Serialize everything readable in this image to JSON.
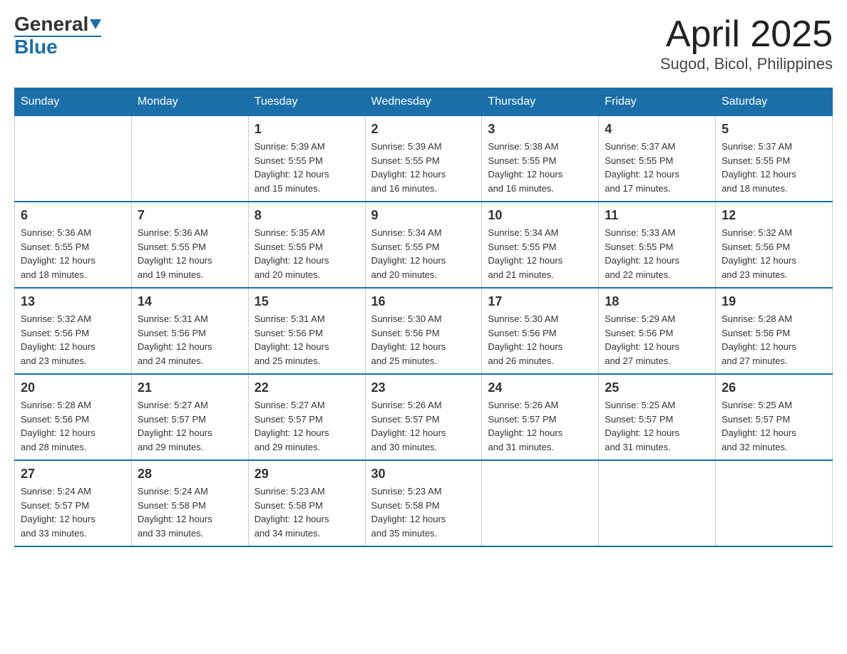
{
  "logo": {
    "general": "General",
    "blue": "Blue"
  },
  "title": "April 2025",
  "subtitle": "Sugod, Bicol, Philippines",
  "headers": [
    "Sunday",
    "Monday",
    "Tuesday",
    "Wednesday",
    "Thursday",
    "Friday",
    "Saturday"
  ],
  "weeks": [
    [
      {
        "day": "",
        "info": ""
      },
      {
        "day": "",
        "info": ""
      },
      {
        "day": "1",
        "info": "Sunrise: 5:39 AM\nSunset: 5:55 PM\nDaylight: 12 hours\nand 15 minutes."
      },
      {
        "day": "2",
        "info": "Sunrise: 5:39 AM\nSunset: 5:55 PM\nDaylight: 12 hours\nand 16 minutes."
      },
      {
        "day": "3",
        "info": "Sunrise: 5:38 AM\nSunset: 5:55 PM\nDaylight: 12 hours\nand 16 minutes."
      },
      {
        "day": "4",
        "info": "Sunrise: 5:37 AM\nSunset: 5:55 PM\nDaylight: 12 hours\nand 17 minutes."
      },
      {
        "day": "5",
        "info": "Sunrise: 5:37 AM\nSunset: 5:55 PM\nDaylight: 12 hours\nand 18 minutes."
      }
    ],
    [
      {
        "day": "6",
        "info": "Sunrise: 5:36 AM\nSunset: 5:55 PM\nDaylight: 12 hours\nand 18 minutes."
      },
      {
        "day": "7",
        "info": "Sunrise: 5:36 AM\nSunset: 5:55 PM\nDaylight: 12 hours\nand 19 minutes."
      },
      {
        "day": "8",
        "info": "Sunrise: 5:35 AM\nSunset: 5:55 PM\nDaylight: 12 hours\nand 20 minutes."
      },
      {
        "day": "9",
        "info": "Sunrise: 5:34 AM\nSunset: 5:55 PM\nDaylight: 12 hours\nand 20 minutes."
      },
      {
        "day": "10",
        "info": "Sunrise: 5:34 AM\nSunset: 5:55 PM\nDaylight: 12 hours\nand 21 minutes."
      },
      {
        "day": "11",
        "info": "Sunrise: 5:33 AM\nSunset: 5:55 PM\nDaylight: 12 hours\nand 22 minutes."
      },
      {
        "day": "12",
        "info": "Sunrise: 5:32 AM\nSunset: 5:56 PM\nDaylight: 12 hours\nand 23 minutes."
      }
    ],
    [
      {
        "day": "13",
        "info": "Sunrise: 5:32 AM\nSunset: 5:56 PM\nDaylight: 12 hours\nand 23 minutes."
      },
      {
        "day": "14",
        "info": "Sunrise: 5:31 AM\nSunset: 5:56 PM\nDaylight: 12 hours\nand 24 minutes."
      },
      {
        "day": "15",
        "info": "Sunrise: 5:31 AM\nSunset: 5:56 PM\nDaylight: 12 hours\nand 25 minutes."
      },
      {
        "day": "16",
        "info": "Sunrise: 5:30 AM\nSunset: 5:56 PM\nDaylight: 12 hours\nand 25 minutes."
      },
      {
        "day": "17",
        "info": "Sunrise: 5:30 AM\nSunset: 5:56 PM\nDaylight: 12 hours\nand 26 minutes."
      },
      {
        "day": "18",
        "info": "Sunrise: 5:29 AM\nSunset: 5:56 PM\nDaylight: 12 hours\nand 27 minutes."
      },
      {
        "day": "19",
        "info": "Sunrise: 5:28 AM\nSunset: 5:56 PM\nDaylight: 12 hours\nand 27 minutes."
      }
    ],
    [
      {
        "day": "20",
        "info": "Sunrise: 5:28 AM\nSunset: 5:56 PM\nDaylight: 12 hours\nand 28 minutes."
      },
      {
        "day": "21",
        "info": "Sunrise: 5:27 AM\nSunset: 5:57 PM\nDaylight: 12 hours\nand 29 minutes."
      },
      {
        "day": "22",
        "info": "Sunrise: 5:27 AM\nSunset: 5:57 PM\nDaylight: 12 hours\nand 29 minutes."
      },
      {
        "day": "23",
        "info": "Sunrise: 5:26 AM\nSunset: 5:57 PM\nDaylight: 12 hours\nand 30 minutes."
      },
      {
        "day": "24",
        "info": "Sunrise: 5:26 AM\nSunset: 5:57 PM\nDaylight: 12 hours\nand 31 minutes."
      },
      {
        "day": "25",
        "info": "Sunrise: 5:25 AM\nSunset: 5:57 PM\nDaylight: 12 hours\nand 31 minutes."
      },
      {
        "day": "26",
        "info": "Sunrise: 5:25 AM\nSunset: 5:57 PM\nDaylight: 12 hours\nand 32 minutes."
      }
    ],
    [
      {
        "day": "27",
        "info": "Sunrise: 5:24 AM\nSunset: 5:57 PM\nDaylight: 12 hours\nand 33 minutes."
      },
      {
        "day": "28",
        "info": "Sunrise: 5:24 AM\nSunset: 5:58 PM\nDaylight: 12 hours\nand 33 minutes."
      },
      {
        "day": "29",
        "info": "Sunrise: 5:23 AM\nSunset: 5:58 PM\nDaylight: 12 hours\nand 34 minutes."
      },
      {
        "day": "30",
        "info": "Sunrise: 5:23 AM\nSunset: 5:58 PM\nDaylight: 12 hours\nand 35 minutes."
      },
      {
        "day": "",
        "info": ""
      },
      {
        "day": "",
        "info": ""
      },
      {
        "day": "",
        "info": ""
      }
    ]
  ]
}
